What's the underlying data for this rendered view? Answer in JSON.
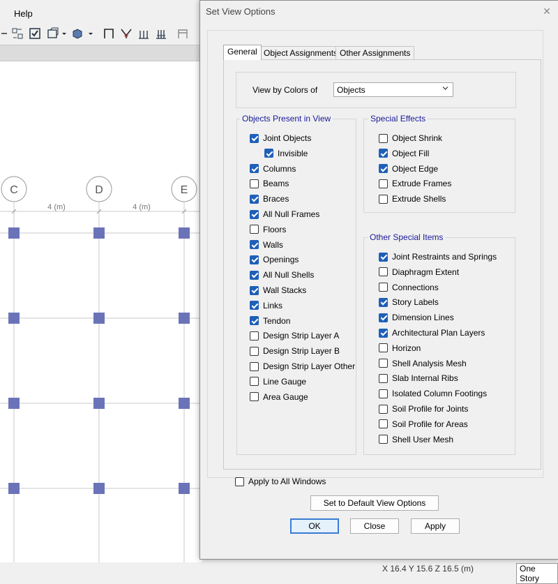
{
  "app": {
    "menu_help": "Help",
    "status_coords": "X 16.4  Y 15.6  Z 16.5 (m)",
    "status_story": "One Story",
    "grid": {
      "bubbles": [
        "C",
        "D",
        "E"
      ],
      "dimensions": [
        "4 (m)",
        "4 (m)"
      ]
    }
  },
  "dialog": {
    "title": "Set View Options",
    "tabs": [
      "General",
      "Object Assignments",
      "Other Assignments"
    ],
    "view_by_label": "View by Colors of",
    "view_by_value": "Objects",
    "objects_group": {
      "title": "Objects Present in View",
      "items": [
        {
          "label": "Joint Objects",
          "checked": true
        },
        {
          "label": "Invisible",
          "checked": true
        },
        {
          "label": "Columns",
          "checked": true
        },
        {
          "label": "Beams",
          "checked": false
        },
        {
          "label": "Braces",
          "checked": true
        },
        {
          "label": "All Null Frames",
          "checked": true
        },
        {
          "label": "Floors",
          "checked": false
        },
        {
          "label": "Walls",
          "checked": true
        },
        {
          "label": "Openings",
          "checked": true
        },
        {
          "label": "All Null Shells",
          "checked": true
        },
        {
          "label": "Wall Stacks",
          "checked": true
        },
        {
          "label": "Links",
          "checked": true
        },
        {
          "label": "Tendon",
          "checked": true
        },
        {
          "label": "Design Strip Layer A",
          "checked": false
        },
        {
          "label": "Design Strip Layer B",
          "checked": false
        },
        {
          "label": "Design Strip Layer Other",
          "checked": false
        },
        {
          "label": "Line Gauge",
          "checked": false
        },
        {
          "label": "Area Gauge",
          "checked": false
        }
      ]
    },
    "effects_group": {
      "title": "Special Effects",
      "items": [
        {
          "label": "Object Shrink",
          "checked": false
        },
        {
          "label": "Object Fill",
          "checked": true
        },
        {
          "label": "Object Edge",
          "checked": true
        },
        {
          "label": "Extrude Frames",
          "checked": false
        },
        {
          "label": "Extrude Shells",
          "checked": false
        }
      ]
    },
    "other_group": {
      "title": "Other Special Items",
      "items": [
        {
          "label": "Joint Restraints and Springs",
          "checked": true
        },
        {
          "label": "Diaphragm Extent",
          "checked": false
        },
        {
          "label": "Connections",
          "checked": false
        },
        {
          "label": "Story Labels",
          "checked": true
        },
        {
          "label": "Dimension Lines",
          "checked": true
        },
        {
          "label": "Architectural Plan Layers",
          "checked": true
        },
        {
          "label": "Horizon",
          "checked": false
        },
        {
          "label": "Shell Analysis Mesh",
          "checked": false
        },
        {
          "label": "Slab Internal Ribs",
          "checked": false
        },
        {
          "label": "Isolated Column Footings",
          "checked": false
        },
        {
          "label": "Soil Profile for Joints",
          "checked": false
        },
        {
          "label": "Soil Profile for Areas",
          "checked": false
        },
        {
          "label": "Shell User Mesh",
          "checked": false
        }
      ]
    },
    "apply_all": {
      "label": "Apply to All Windows",
      "checked": false
    },
    "default_button": "Set to Default View Options",
    "ok_button": "OK",
    "close_button": "Close",
    "apply_button": "Apply",
    "colors": {
      "accent": "#1f5fb8",
      "group_title": "#1a1a9a",
      "joint": "#6b73b8"
    }
  }
}
